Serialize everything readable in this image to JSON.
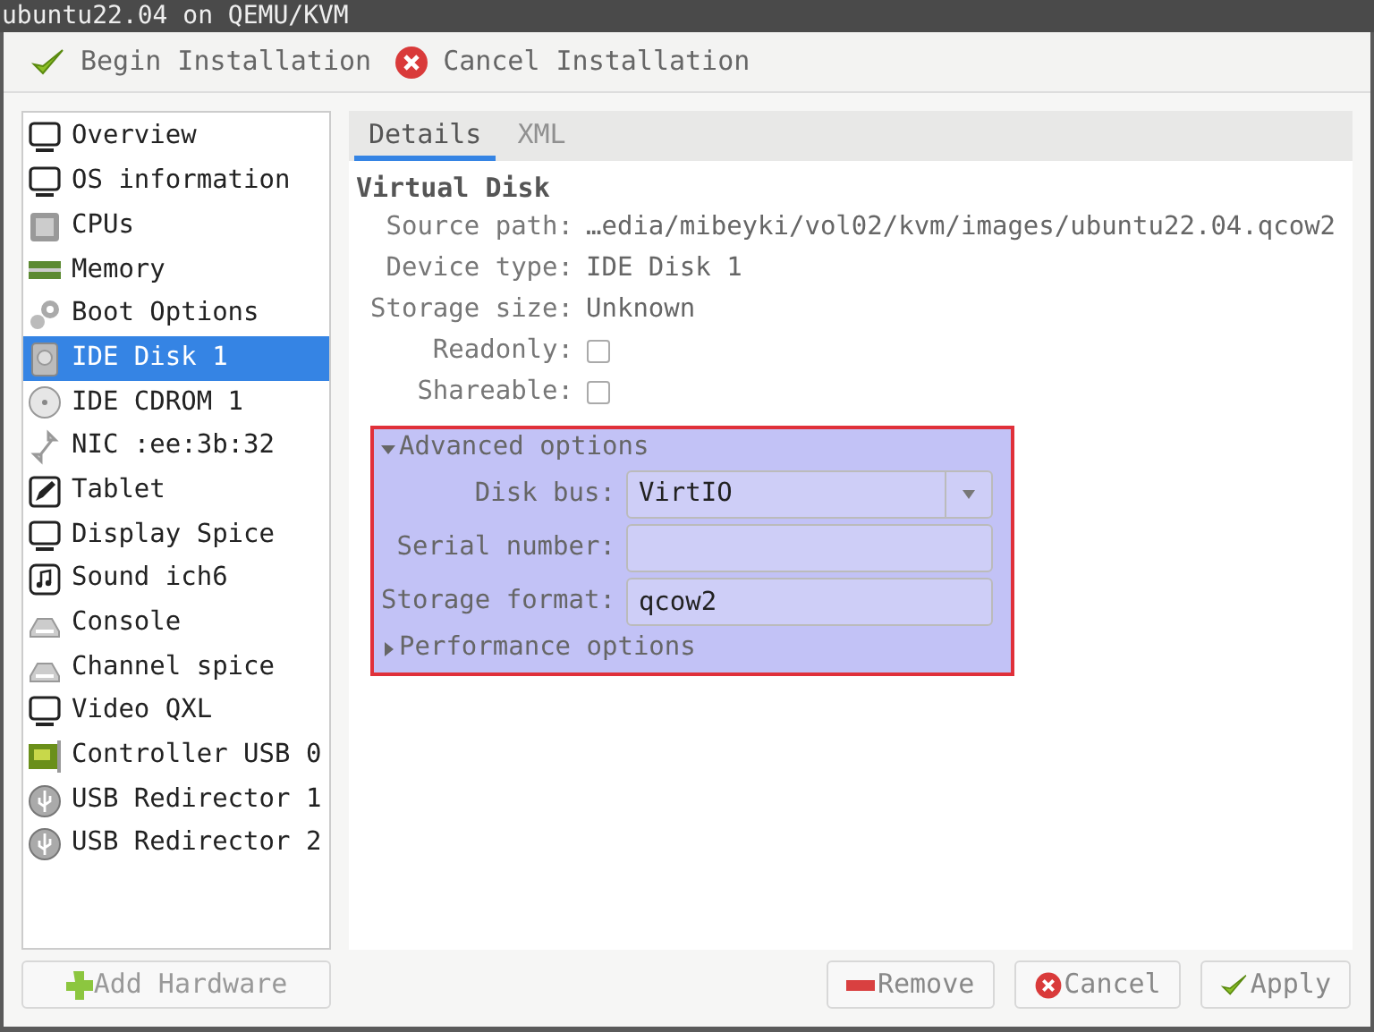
{
  "window": {
    "title": "ubuntu22.04 on QEMU/KVM"
  },
  "toolbar": [
    {
      "label": "Begin Installation",
      "kind": "begin"
    },
    {
      "label": "Cancel Installation",
      "kind": "cancel"
    }
  ],
  "sidebar": {
    "items": [
      {
        "label": "Overview",
        "selected": false
      },
      {
        "label": "OS information",
        "selected": false
      },
      {
        "label": "CPUs",
        "selected": false
      },
      {
        "label": "Memory",
        "selected": false
      },
      {
        "label": "Boot Options",
        "selected": false
      },
      {
        "label": "IDE Disk 1",
        "selected": true
      },
      {
        "label": "IDE CDROM 1",
        "selected": false
      },
      {
        "label": "NIC :ee:3b:32",
        "selected": false
      },
      {
        "label": "Tablet",
        "selected": false
      },
      {
        "label": "Display Spice",
        "selected": false
      },
      {
        "label": "Sound ich6",
        "selected": false
      },
      {
        "label": "Console",
        "selected": false
      },
      {
        "label": "Channel spice",
        "selected": false
      },
      {
        "label": "Video QXL",
        "selected": false
      },
      {
        "label": "Controller USB 0",
        "selected": false
      },
      {
        "label": "USB Redirector 1",
        "selected": false
      },
      {
        "label": "USB Redirector 2",
        "selected": false
      }
    ],
    "add_button": "Add Hardware"
  },
  "tabs": [
    {
      "label": "Details",
      "selected": true
    },
    {
      "label": "XML",
      "selected": false
    }
  ],
  "section_title": "Virtual Disk",
  "details": [
    {
      "label": "Source path:",
      "kind": "text",
      "value": "…edia/mibeyki/vol02/kvm/images/ubuntu22.04.qcow2"
    },
    {
      "label": "Device type:",
      "kind": "text",
      "value": "IDE Disk 1"
    },
    {
      "label": "Storage size:",
      "kind": "text",
      "value": "Unknown"
    },
    {
      "label": "Readonly:",
      "kind": "checkbox",
      "checked": false
    },
    {
      "label": "Shareable:",
      "kind": "checkbox",
      "checked": false
    }
  ],
  "advanced": {
    "label": "Advanced options",
    "expanded": true,
    "fields": [
      {
        "label": "Disk bus:",
        "kind": "dropdown",
        "value": "VirtIO"
      },
      {
        "label": "Serial number:",
        "kind": "input"
      },
      {
        "label": "Storage format:",
        "kind": "input",
        "value": "qcow2"
      }
    ]
  },
  "performance": {
    "label": "Performance options",
    "expanded": false
  },
  "buttons": [
    {
      "label": "Remove",
      "kind": "remove"
    },
    {
      "label": "Cancel",
      "kind": "cancel"
    },
    {
      "label": "Apply",
      "kind": "apply"
    }
  ]
}
